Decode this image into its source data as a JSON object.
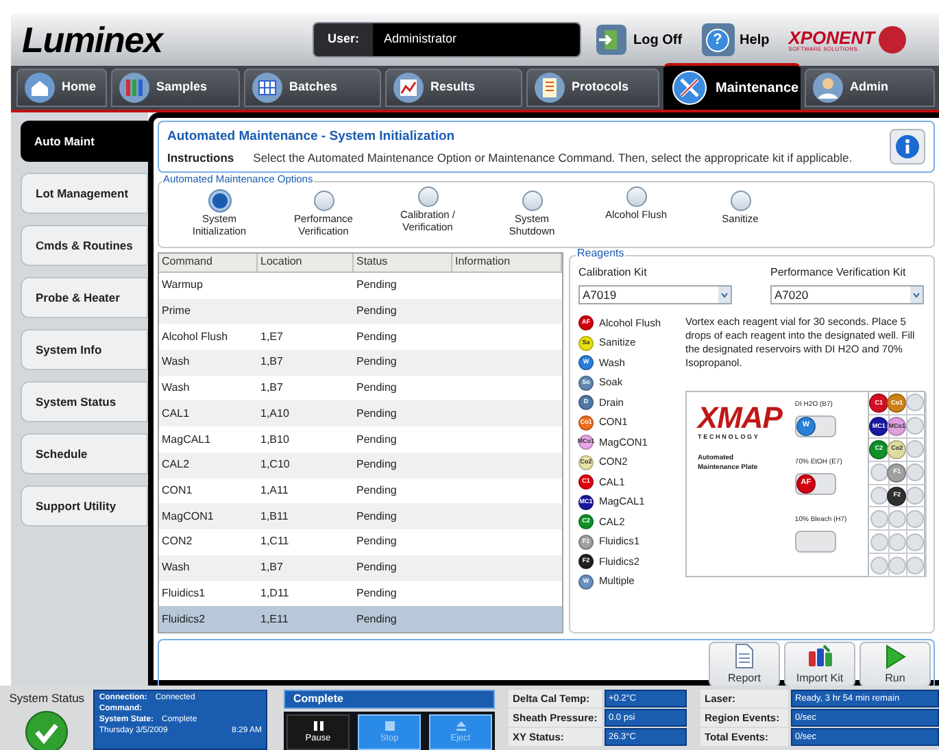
{
  "header": {
    "logo": "Luminex",
    "user_label": "User:",
    "user_value": "Administrator",
    "logoff": "Log Off",
    "help_icon": "?",
    "help": "Help",
    "brand": "XPONENT",
    "brand_sub": "SOFTWARE SOLUTIONS"
  },
  "nav_tabs": [
    {
      "label": "Home",
      "selected": false
    },
    {
      "label": "Samples",
      "selected": false
    },
    {
      "label": "Batches",
      "selected": false
    },
    {
      "label": "Results",
      "selected": false
    },
    {
      "label": "Protocols",
      "selected": false
    },
    {
      "label": "Maintenance",
      "selected": true
    },
    {
      "label": "Admin",
      "selected": false
    }
  ],
  "sidebar": {
    "items": [
      {
        "label": "Auto Maint",
        "selected": true
      },
      {
        "label": "Lot Management",
        "selected": false
      },
      {
        "label": "Cmds & Routines",
        "selected": false
      },
      {
        "label": "Probe & Heater",
        "selected": false
      },
      {
        "label": "System Info",
        "selected": false
      },
      {
        "label": "System Status",
        "selected": false
      },
      {
        "label": "Schedule",
        "selected": false
      },
      {
        "label": "Support Utility",
        "selected": false
      }
    ]
  },
  "title_panel": {
    "title": "Automated Maintenance - System Initialization",
    "instructions_label": "Instructions",
    "instructions": "Select the Automated Maintenance Option or Maintenance Command. Then, select the appropricate kit if applicable."
  },
  "options": {
    "legend": "Automated Maintenance Options",
    "items": [
      {
        "label": "System Initialization",
        "selected": true
      },
      {
        "label": "Performance Verification",
        "selected": false
      },
      {
        "label": "Calibration / Verification",
        "selected": false
      },
      {
        "label": "System Shutdown",
        "selected": false
      },
      {
        "label": "Alcohol Flush",
        "selected": false
      },
      {
        "label": "Sanitize",
        "selected": false
      }
    ]
  },
  "table": {
    "columns": [
      "Command",
      "Location",
      "Status",
      "Information"
    ],
    "rows": [
      {
        "command": "Warmup",
        "status": "Pending",
        "selected": false
      },
      {
        "command": "Prime",
        "status": "Pending",
        "selected": false
      },
      {
        "command": "Alcohol Flush",
        "location": "1,E7",
        "status": "Pending",
        "selected": false
      },
      {
        "command": "Wash",
        "location": "1,B7",
        "status": "Pending",
        "selected": false
      },
      {
        "command": "Wash",
        "location": "1,B7",
        "status": "Pending",
        "selected": false
      },
      {
        "command": "CAL1",
        "location": "1,A10",
        "status": "Pending",
        "selected": false
      },
      {
        "command": "MagCAL1",
        "location": "1,B10",
        "status": "Pending",
        "selected": false
      },
      {
        "command": "CAL2",
        "location": "1,C10",
        "status": "Pending",
        "selected": false
      },
      {
        "command": "CON1",
        "location": "1,A11",
        "status": "Pending",
        "selected": false
      },
      {
        "command": "MagCON1",
        "location": "1,B11",
        "status": "Pending",
        "selected": false
      },
      {
        "command": "CON2",
        "location": "1,C11",
        "status": "Pending",
        "selected": false
      },
      {
        "command": "Wash",
        "location": "1,B7",
        "status": "Pending",
        "selected": false
      },
      {
        "command": "Fluidics1",
        "location": "1,D11",
        "status": "Pending",
        "selected": false
      },
      {
        "command": "Fluidics2",
        "location": "1,E11",
        "status": "Pending",
        "selected": true
      }
    ]
  },
  "reagents": {
    "legend": "Reagents",
    "kits": [
      {
        "label": "Calibration Kit",
        "value": "A7019"
      },
      {
        "label": "Performance Verification Kit",
        "value": "A7020"
      }
    ],
    "legend_items": [
      {
        "abbr": "AF",
        "label": "Alcohol Flush",
        "color": "#d00010"
      },
      {
        "abbr": "Sa",
        "label": "Sanitize",
        "color": "#e8e010"
      },
      {
        "abbr": "W",
        "label": "Wash",
        "color": "#2a80d8"
      },
      {
        "abbr": "So",
        "label": "Soak",
        "color": "#6088b0"
      },
      {
        "abbr": "D",
        "label": "Drain",
        "color": "#5078a8"
      },
      {
        "abbr": "Co1",
        "label": "CON1",
        "color": "#f07020"
      },
      {
        "abbr": "MCo1",
        "label": "MagCON1",
        "color": "#e8a8e8"
      },
      {
        "abbr": "Co2",
        "label": "CON2",
        "color": "#e8e4a8"
      },
      {
        "abbr": "C1",
        "label": "CAL1",
        "color": "#e00010"
      },
      {
        "abbr": "MC1",
        "label": "MagCAL1",
        "color": "#1818a0"
      },
      {
        "abbr": "C2",
        "label": "CAL2",
        "color": "#109028"
      },
      {
        "abbr": "F1",
        "label": "Fluidics1",
        "color": "#a0a0a0"
      },
      {
        "abbr": "F2",
        "label": "Fluidics2",
        "color": "#202020"
      },
      {
        "abbr": "W",
        "label": "Multiple",
        "color": "#6890c0"
      }
    ],
    "note": "Vortex each reagent vial for 30 seconds. Place 5 drops of each reagent into the designated well. Fill the designated reservoirs with DI H2O and 70% Isopropanol.",
    "plate": {
      "logo": "XMAP",
      "logo_sub": "TECHNOLOGY",
      "caption": "Automated Maintenance Plate",
      "reservoirs": [
        {
          "label": "DI H2O (B7)",
          "filled": true,
          "abbr": "W",
          "color": "#2a80d8"
        },
        {
          "label": "70% EtOH (E7)",
          "filled": true,
          "abbr": "AF",
          "color": "#d00010"
        },
        {
          "label": "10% Bleach (H7)",
          "filled": false
        }
      ],
      "wells": [
        {
          "filled": true,
          "abbr": "C1",
          "color": "#d01020"
        },
        {
          "filled": true,
          "abbr": "Co1",
          "color": "#d08018"
        },
        {
          "filled": false
        },
        {
          "filled": true,
          "abbr": "MC1",
          "color": "#1818a0"
        },
        {
          "filled": true,
          "abbr": "MCo1",
          "color": "#e0a0e0"
        },
        {
          "filled": false
        },
        {
          "filled": true,
          "abbr": "C2",
          "color": "#109028"
        },
        {
          "filled": true,
          "abbr": "Co2",
          "color": "#e0dca0"
        },
        {
          "filled": false
        },
        {
          "filled": false
        },
        {
          "filled": true,
          "abbr": "F1",
          "color": "#a0a0a0"
        },
        {
          "filled": false
        },
        {
          "filled": false
        },
        {
          "filled": true,
          "abbr": "F2",
          "color": "#303030"
        },
        {
          "filled": false
        },
        {
          "filled": false
        },
        {
          "filled": false
        },
        {
          "filled": false
        },
        {
          "filled": false
        },
        {
          "filled": false
        },
        {
          "filled": false
        },
        {
          "filled": false
        },
        {
          "filled": false
        },
        {
          "filled": false
        }
      ]
    }
  },
  "actions": [
    {
      "kind": "report",
      "label": "Report"
    },
    {
      "kind": "import",
      "label": "Import Kit"
    },
    {
      "kind": "run",
      "label": "Run"
    }
  ],
  "status_bar": {
    "title": "System Status",
    "info": [
      {
        "label": "Connection:",
        "value": "Connected"
      },
      {
        "label": "Command:"
      },
      {
        "label": "System State:",
        "value": "Complete"
      }
    ],
    "date": "Thursday 3/5/2009",
    "time": "8:29 AM",
    "state": "Complete",
    "controls": [
      {
        "kind": "pause",
        "label": "Pause",
        "disabled": false
      },
      {
        "kind": "stop",
        "label": "Stop",
        "disabled": true
      },
      {
        "kind": "eject",
        "label": "Eject",
        "disabled": true
      }
    ],
    "readings_left": [
      {
        "label": "Delta Cal Temp:",
        "value": "+0.2°C"
      },
      {
        "label": "Sheath Pressure:",
        "value": "0.0 psi"
      },
      {
        "label": "XY Status:",
        "value": "26.3°C"
      }
    ],
    "readings_right": [
      {
        "label": "Laser:",
        "value": "Ready, 3 hr 54 min remain"
      },
      {
        "label": "Region Events:",
        "value": "0/sec"
      },
      {
        "label": "Total Events:",
        "value": "0/sec"
      }
    ]
  }
}
